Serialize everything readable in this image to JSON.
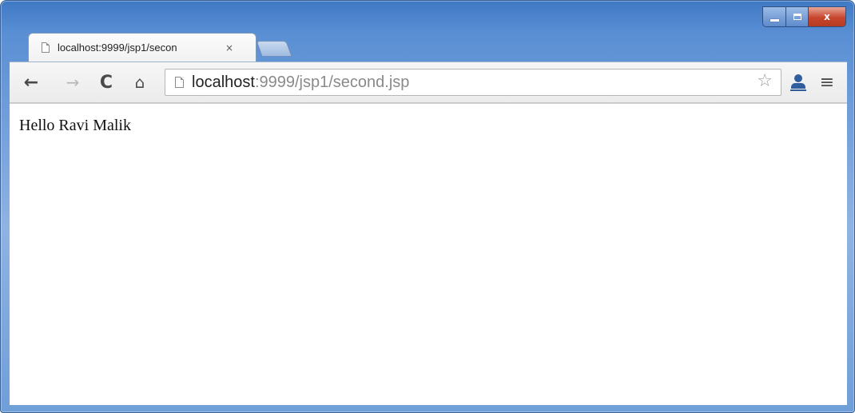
{
  "tab": {
    "title": "localhost:9999/jsp1/secon",
    "close_glyph": "×"
  },
  "window_controls": {
    "close_glyph": "x"
  },
  "toolbar": {
    "back_glyph": "←",
    "forward_glyph": "→",
    "reload_glyph": "C",
    "home_glyph": "⌂",
    "menu_glyph": "≡",
    "star_glyph": "☆"
  },
  "omnibox": {
    "host": "localhost",
    "path": ":9999/jsp1/second.jsp"
  },
  "page": {
    "text": "Hello Ravi Malik"
  },
  "icons": [
    "page-icon",
    "close-icon",
    "back-icon",
    "forward-icon",
    "reload-icon",
    "home-icon",
    "star-icon",
    "extension-icon",
    "menu-icon"
  ],
  "colors": {
    "frame": "#5a8fd4",
    "close_button": "#c7452d",
    "host_text": "#222222",
    "path_text": "#8a8a8a"
  }
}
